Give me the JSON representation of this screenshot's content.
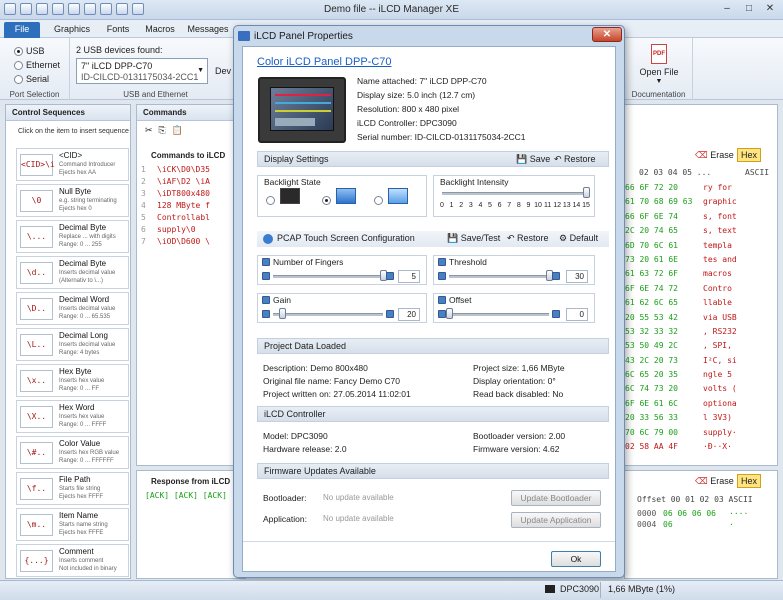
{
  "window": {
    "title": "Demo file -- iLCD Manager XE"
  },
  "menu": {
    "tabs": [
      "File",
      "Graphics",
      "Fonts",
      "Macros",
      "Messages"
    ]
  },
  "ribbon": {
    "port_selection": {
      "label": "Port Selection",
      "options": [
        "USB",
        "Ethernet",
        "Serial"
      ],
      "selected": "USB"
    },
    "usb": {
      "found_label": "2 USB devices found:",
      "device": "7\" iLCD DPP-C70",
      "device_id": "ID-CILCD-0131175034-2CC1",
      "group_label": "USB and Ethernet",
      "dev_button": "Dev"
    },
    "documentation": {
      "open_file": "Open File",
      "group_label": "Documentation",
      "pdf": "PDF"
    }
  },
  "control_sequences": {
    "title": "Control Sequences",
    "hint": "Click on the item to insert sequence",
    "items": [
      {
        "code": "<CID>\\i",
        "name": "<CID>",
        "d1": "Command Introducer",
        "d2": "Ejects hex AA"
      },
      {
        "code": "\\0",
        "name": "Null Byte",
        "d1": "e.g. string terminating",
        "d2": "Ejects hex 0"
      },
      {
        "code": "\\...",
        "name": "Decimal Byte",
        "d1": "Replace ... with digits",
        "d2": "Range: 0 ... 255"
      },
      {
        "code": "\\d..",
        "name": "Decimal Byte",
        "d1": "Inserts decimal value",
        "d2": "(Alternativ to \\...)"
      },
      {
        "code": "\\D..",
        "name": "Decimal Word",
        "d1": "Inserts decimal value",
        "d2": "Range: 0 ... 65.535"
      },
      {
        "code": "\\L..",
        "name": "Decimal Long",
        "d1": "Inserts decimal value",
        "d2": "Range: 4 bytes"
      },
      {
        "code": "\\x..",
        "name": "Hex Byte",
        "d1": "Inserts hex value",
        "d2": "Range: 0 ... FF"
      },
      {
        "code": "\\X..",
        "name": "Hex Word",
        "d1": "Inserts hex value",
        "d2": "Range: 0 ... FFFF"
      },
      {
        "code": "\\#..",
        "name": "Color Value",
        "d1": "Inserts hex RGB value",
        "d2": "Range: 0 ... FFFFFF"
      },
      {
        "code": "\\f..",
        "name": "File Path",
        "d1": "Starts file string",
        "d2": "Ejects hex FFFF"
      },
      {
        "code": "\\m..",
        "name": "Item Name",
        "d1": "Starts name string",
        "d2": "Ejects hex FFFE"
      },
      {
        "code": "{...}",
        "name": "Comment",
        "d1": "Inserts comment",
        "d2": "Not included in binary"
      }
    ]
  },
  "commands": {
    "title": "Commands",
    "to_ilcd": "Commands to iLCD",
    "lines": [
      {
        "n": "1",
        "t": "\\iCK\\D0\\D35"
      },
      {
        "n": "2",
        "t": "\\iAF\\D2 \\iA"
      },
      {
        "n": "3",
        "t": "\\iDT800x480"
      },
      {
        "n": "4",
        "t": "128 MByte f"
      },
      {
        "n": "5",
        "t": "Controllabl"
      },
      {
        "n": "6",
        "t": "supply\\0"
      },
      {
        "n": "7",
        "t": "\\iOD\\D600 \\"
      }
    ],
    "response_title": "Response from iLCD",
    "response": "[ACK] [ACK] [ACK] [ACK"
  },
  "hexview": {
    "erase": "Erase",
    "hex": "Hex",
    "ascii_label": "ASCII",
    "offsets_header": "02 03 04 05 ...",
    "rows": [
      {
        "hex": "66 6F 72 20",
        "ascii": "ry for"
      },
      {
        "hex": "61 70 68 69 63",
        "ascii": "graphic"
      },
      {
        "hex": "66 6F 6E 74",
        "ascii": "s, font"
      },
      {
        "hex": "2C 20 74 65",
        "ascii": "s, text"
      },
      {
        "hex": "6D 70 6C 61",
        "ascii": " templa"
      },
      {
        "hex": "73 20 61 6E",
        "ascii": "tes and"
      },
      {
        "hex": "61 63 72 6F",
        "ascii": " macros"
      },
      {
        "hex": "6F 6E 74 72",
        "ascii": " Contro"
      },
      {
        "hex": "61 62 6C 65",
        "ascii": "llable"
      },
      {
        "hex": "20 55 53 42",
        "ascii": "via USB"
      },
      {
        "hex": "53 32 33 32",
        "ascii": ", RS232"
      },
      {
        "hex": "53 50 49 2C",
        "ascii": ", SPI,"
      },
      {
        "hex": "43 2C 20 73",
        "ascii": "I²C, si"
      },
      {
        "hex": "6C 65 20 35",
        "ascii": "ngle 5"
      },
      {
        "hex": "6C 74 73 20",
        "ascii": "volts ("
      },
      {
        "hex": "6F 6E 61 6C",
        "ascii": "optiona"
      },
      {
        "hex": "20 33 56 33",
        "ascii": "l 3V3)"
      },
      {
        "hex": "70 6C 79 00",
        "ascii": "supply·"
      },
      {
        "hex": "02 58 AA 4F",
        "ascii": "·Ð··X·"
      }
    ],
    "resp_header": "Offset 00 01 02 03 ASCII",
    "resp_rows": [
      {
        "off": "0000",
        "hex": "06 06 06 06",
        "ascii": "····"
      },
      {
        "off": "0004",
        "hex": "06",
        "ascii": "·"
      }
    ]
  },
  "dialog": {
    "title": "iLCD Panel Properties",
    "panel_link": "Color iLCD Panel DPP-C70",
    "info": [
      "Name attached: 7\" iLCD DPP-C70",
      "Display size: 5.0 inch (12.7 cm)",
      "Resolution: 800 x 480 pixel",
      "iLCD Controller: DPC3090",
      "Serial number: ID-CILCD-0131175034-2CC1"
    ],
    "display_settings": {
      "title": "Display Settings",
      "save": "Save",
      "restore": "Restore",
      "backlight_state": "Backlight State",
      "backlight_intensity": "Backlight Intensity",
      "ticks": [
        "0",
        "1",
        "2",
        "3",
        "4",
        "5",
        "6",
        "7",
        "8",
        "9",
        "10",
        "11",
        "12",
        "13",
        "14",
        "15"
      ],
      "intensity_value": 15,
      "intensity_max": 15
    },
    "pcap": {
      "title": "PCAP Touch Screen Configuration",
      "save_test": "Save/Test",
      "restore": "Restore",
      "default": "Default",
      "fingers": {
        "label": "Number of Fingers",
        "value": "5",
        "max": 5
      },
      "threshold": {
        "label": "Threshold",
        "value": "30",
        "max": 30
      },
      "gain": {
        "label": "Gain",
        "value": "20",
        "max": 255
      },
      "offset": {
        "label": "Offset",
        "value": "0",
        "max": 255
      }
    },
    "project": {
      "title": "Project Data Loaded",
      "description": "Description: Demo 800x480",
      "original": "Original file name: Fancy Demo C70",
      "written": "Project written on: 27.05.2014 11:02:01",
      "size": "Project size: 1,66 MByte",
      "orientation": "Display orientation: 0°",
      "readback": "Read back disabled: No"
    },
    "controller": {
      "title": "iLCD Controller",
      "model": "Model: DPC3090",
      "hw": "Hardware release: 2.0",
      "bootloader": "Bootloader version: 2.00",
      "firmware": "Firmware version: 4.62"
    },
    "firmware": {
      "title": "Firmware Updates Available",
      "bootloader_label": "Bootloader:",
      "bootloader_status": "No update available",
      "update_bootloader": "Update Bootloader",
      "application_label": "Application:",
      "application_status": "No update available",
      "update_application": "Update Application"
    },
    "ok": "Ok"
  },
  "status": {
    "controller": "DPC3090",
    "size": "1,66 MByte (1%)"
  }
}
